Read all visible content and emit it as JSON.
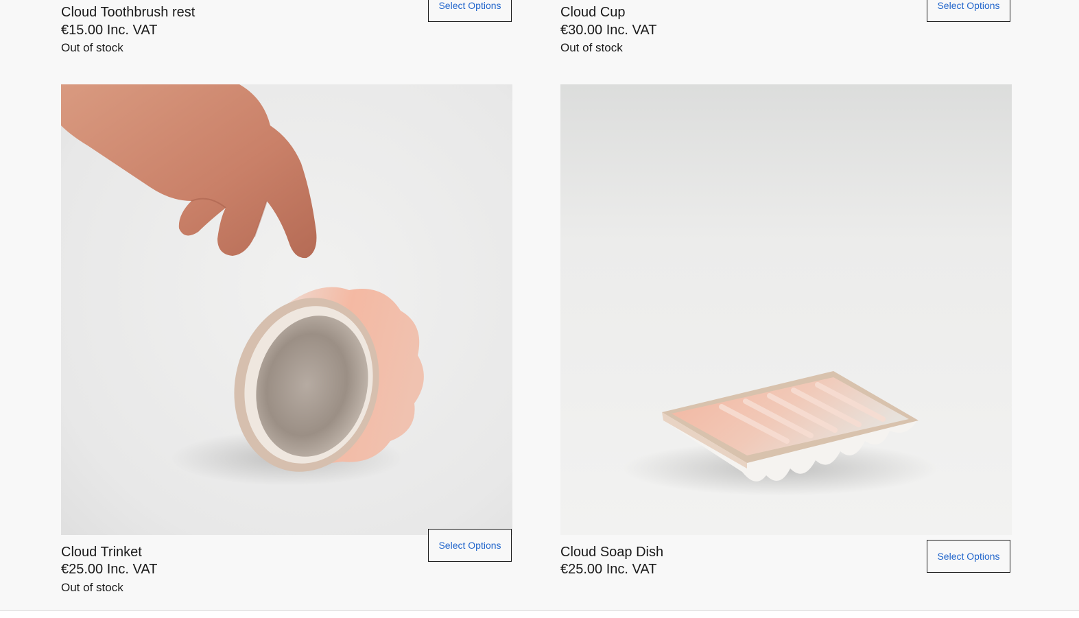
{
  "products": [
    {
      "name": "Cloud Toothbrush rest",
      "price": "€15.00 Inc. VAT",
      "stock": "Out of stock",
      "button": "Select Options"
    },
    {
      "name": "Cloud Cup",
      "price": "€30.00 Inc. VAT",
      "stock": "Out of stock",
      "button": "Select Options"
    },
    {
      "name": "Cloud Trinket",
      "price": "€25.00 Inc. VAT",
      "stock": "Out of stock",
      "button": "Select Options",
      "image": "hand-tipping-scalloped-pink-ceramic-bowl"
    },
    {
      "name": "Cloud Soap Dish",
      "price": "€25.00 Inc. VAT",
      "stock": "",
      "button": "Select Options",
      "image": "scalloped-pink-ceramic-soap-dish"
    }
  ],
  "colors": {
    "background": "#f8f8f8",
    "button_text": "#2266cc",
    "button_border": "#1a1a1a",
    "glaze_pink": "#f2b7a2",
    "clay_rim": "#d9c3b3"
  }
}
